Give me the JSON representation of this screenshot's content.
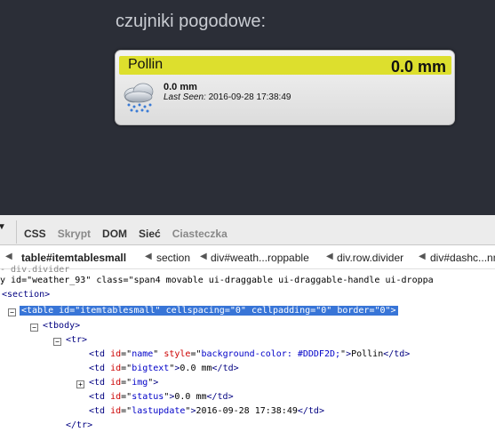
{
  "dashboard": {
    "section_title": "czujniki pogodowe:",
    "card": {
      "name": "Pollin",
      "bigtext": "0.0 mm",
      "status": "0.0 mm",
      "last_seen_label": "Last Seen:",
      "last_seen_value": "2016-09-28 17:38:49",
      "header_color": "#DDDF2D",
      "icon": "rain-cloud-icon"
    }
  },
  "devtools": {
    "tabs": [
      "CSS",
      "Skrypt",
      "DOM",
      "Sieć",
      "Ciasteczka"
    ],
    "breadcrumbs": [
      "table#itemtablesmall",
      "section",
      "div#weath...roppable",
      "div.row.divider",
      "div#dashc...nn"
    ],
    "tree": {
      "line0": "y id=\"weather_93\" class=\"span4 movable ui-draggable ui-draggable-handle ui-droppa",
      "line1": "<section>",
      "line2_prefix": "<table ",
      "line2_attrs": [
        {
          "name": "id",
          "value": "itemtablesmall"
        },
        {
          "name": "cellspacing",
          "value": "0"
        },
        {
          "name": "cellpadding",
          "value": "0"
        },
        {
          "name": "border",
          "value": "0"
        }
      ],
      "line3": "<tbody>",
      "line4": "<tr>",
      "td_name_style": "background-color: #DDDF2D;",
      "td_name_text": "Pollin",
      "td_bigtext_text": "0.0 mm",
      "td_status_text": "0.0 mm",
      "td_lastupdate_text": "2016-09-28 17:38:49",
      "line_close_tr": "</tr>"
    }
  }
}
